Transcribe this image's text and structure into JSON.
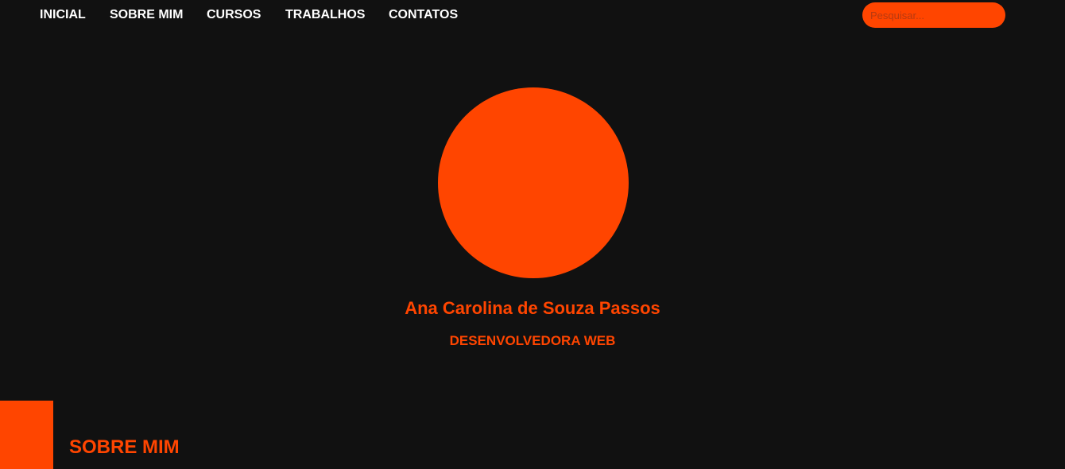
{
  "nav": {
    "items": [
      {
        "label": "INICIAL"
      },
      {
        "label": "SOBRE MIM"
      },
      {
        "label": "CURSOS"
      },
      {
        "label": "TRABALHOS"
      },
      {
        "label": "CONTATOS"
      }
    ],
    "search": {
      "placeholder": "Pesquisar...",
      "value": ""
    }
  },
  "hero": {
    "name": "Ana Carolina de Souza Passos",
    "role": "DESENVOLVEDORA WEB"
  },
  "about_section": {
    "title": "SOBRE MIM"
  },
  "colors": {
    "background": "#111111",
    "accent": "#ff4500",
    "nav_text": "#ffffff"
  }
}
